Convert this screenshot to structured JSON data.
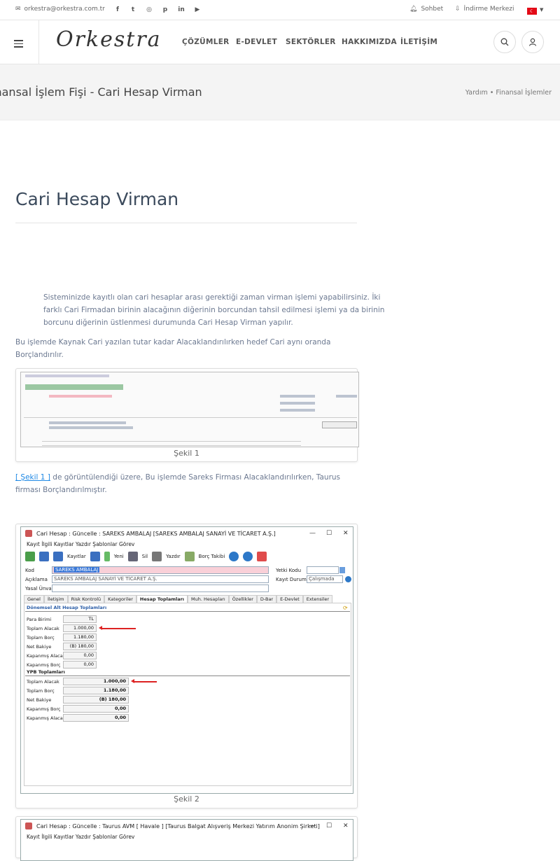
{
  "topbar": {
    "email": "orkestra@orkestra.com.tr",
    "social_icons": [
      "facebook-icon",
      "twitter-icon",
      "instagram-icon",
      "pinterest-icon",
      "linkedin-icon",
      "youtube-icon"
    ],
    "chat_label": "Sohbet",
    "download_label": "İndirme Merkezi",
    "language": "TR"
  },
  "nav": {
    "logo": "Orkestra",
    "items": [
      "ÇÖZÜMLER",
      "E-DEVLET",
      "SEKTÖRLER",
      "HAKKIMIZDA",
      "İLETİŞİM"
    ]
  },
  "hero": {
    "title": "Finansal İşlem Fişi - Cari Hesap Virman",
    "breadcrumb_1": "Yardım",
    "breadcrumb_sep": "•",
    "breadcrumb_2": "Finansal İşlemler"
  },
  "article": {
    "title": "Cari Hesap Virman",
    "quote": "Sisteminizde kayıtlı olan cari hesaplar arası gerektiği zaman virman işlemi yapabilirsiniz. İki farklı Cari Firmadan birinin alacağının diğerinin borcundan tahsil edilmesi işlemi ya da birinin borcunu diğerinin üstlenmesi durumunda Cari Hesap Virman yapılır.",
    "para1": "Bu işlemde Kaynak Cari yazılan tutar kadar Alacaklandırılırken hedef Cari aynı oranda Borçlandırılır.",
    "fig1_caption": "Şekil 1",
    "para2_link": "[ Şekil 1 ]",
    "para2": " de görüntülendiği üzere, Bu işlemde Sareks Firması Alacaklandırılırken, Taurus firması Borçlandırılmıştır.",
    "fig2_caption": "Şekil 2"
  },
  "fig2": {
    "window_title": "Cari Hesap : Güncelle : SAREKS AMBALAJ [SAREKS AMBALAJ SANAYİ VE TİCARET A.Ş.]",
    "menu": "Kayıt   İlgili Kayıtlar   Yazdır   Şablonlar   Görev",
    "toolbar": [
      "Kayıtlar",
      "Yeni",
      "Sil",
      "Yazdır",
      "Borç Takibi"
    ],
    "kod_label": "Kod",
    "kod_value": "SAREKS AMBALAJ",
    "aciklama_label": "Açıklama",
    "aciklama_value": "SAREKS AMBALAJ SANAYİ VE TİCARET A.Ş.",
    "yasal_label": "Yasal Ünvan",
    "yetki_label": "Yetki Kodu",
    "durum_label": "Kayıt Durumu",
    "durum_value": "Çalışmada",
    "tabs": [
      "Genel",
      "İletişim",
      "Risk Kontrolü",
      "Kategoriler",
      "Hesap Toplamları",
      "Muh. Hesapları",
      "Özellikler",
      "D-Bar",
      "E-Devlet",
      "Extensiler"
    ],
    "section1": "Dönemsel Alt Hesap Toplamları",
    "para_birimi_label": "Para Birimi",
    "para_birimi_value": "TL",
    "rows1": [
      {
        "label": "Toplam Alacak",
        "value": "1.000,00"
      },
      {
        "label": "Toplam Borç",
        "value": "1.180,00"
      },
      {
        "label": "Net Bakiye",
        "value": "(B) 180,00"
      },
      {
        "label": "Kapanmış Alacak",
        "value": "0,00"
      },
      {
        "label": "Kapanmış Borç",
        "value": "0,00"
      }
    ],
    "section2": "YPB Toplamları",
    "rows2": [
      {
        "label": "Toplam Alacak",
        "value": "1.000,00"
      },
      {
        "label": "Toplam Borç",
        "value": "1.180,00"
      },
      {
        "label": "Net Bakiye",
        "value": "(B) 180,00"
      },
      {
        "label": "Kapanmış Borç",
        "value": "0,00"
      },
      {
        "label": "Kapanmış Alacak",
        "value": "0,00"
      }
    ]
  },
  "fig3": {
    "window_title": "Cari Hesap : Güncelle : Taurus AVM [ Havale ] [Taurus Balgat Alışveriş Merkezi Yatırım Anonim Şirketi]",
    "menu": "Kayıt   İlgili Kayıtlar   Yazdır   Şablonlar   Görev"
  },
  "colors": {
    "accent": "#1e88e5",
    "text": "#6b7890",
    "arrow": "#d22222"
  }
}
